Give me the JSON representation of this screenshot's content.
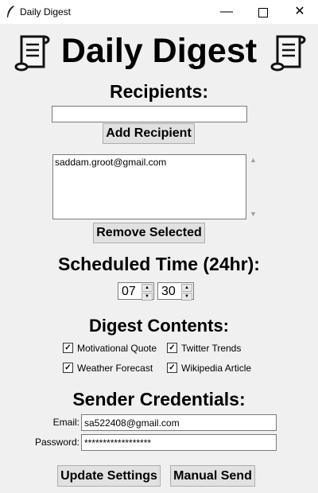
{
  "window": {
    "title": "Daily Digest",
    "minimize": "—",
    "close": "✕"
  },
  "heading": {
    "title": "Daily Digest",
    "icon": "scroll-icon"
  },
  "recipients": {
    "title": "Recipients:",
    "input_value": "",
    "add_button": "Add Recipient",
    "list": [
      "saddam.groot@gmail.com"
    ],
    "remove_button": "Remove Selected"
  },
  "schedule": {
    "title": "Scheduled Time (24hr):",
    "hour": "07",
    "minute": "30"
  },
  "contents": {
    "title": "Digest Contents:",
    "options": [
      {
        "label": "Motivational Quote",
        "checked": true
      },
      {
        "label": "Twitter Trends",
        "checked": true
      },
      {
        "label": "Weather Forecast",
        "checked": true
      },
      {
        "label": "Wikipedia Article",
        "checked": true
      }
    ],
    "check_mark": "✓"
  },
  "credentials": {
    "title": "Sender Credentials:",
    "email_label": "Email:",
    "email_value": "sa522408@gmail.com",
    "password_label": "Password:",
    "password_value": "******************"
  },
  "actions": {
    "update": "Update Settings",
    "send": "Manual Send"
  }
}
